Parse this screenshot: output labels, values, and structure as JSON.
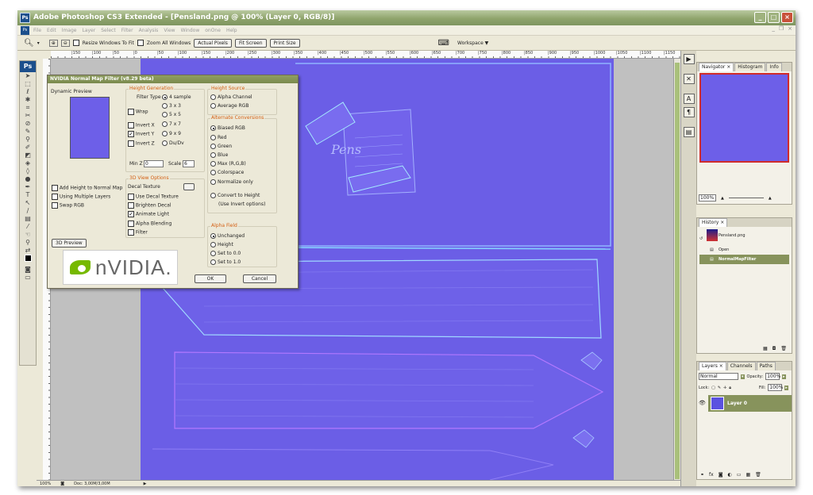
{
  "window": {
    "title": "Adobe Photoshop CS3 Extended - [Pensland.png @ 100% (Layer 0, RGB/8)]",
    "ps_badge": "Ps"
  },
  "menu": [
    "File",
    "Edit",
    "Image",
    "Layer",
    "Select",
    "Filter",
    "Analysis",
    "View",
    "Window",
    "onOne",
    "Help"
  ],
  "options": {
    "resize_windows": "Resize Windows To Fit",
    "zoom_all": "Zoom All Windows",
    "actual_pixels": "Actual Pixels",
    "fit_screen": "Fit Screen",
    "print_size": "Print Size",
    "workspace": "Workspace ▼"
  },
  "ruler_ticks": [
    "|150",
    "|100",
    "|50",
    "|0",
    "|50",
    "|100",
    "|150",
    "|200",
    "|250",
    "|300",
    "|350",
    "|400",
    "|450",
    "|500",
    "|550",
    "|600",
    "|650",
    "|700",
    "|750",
    "|800",
    "|850",
    "|900",
    "|950",
    "|1000",
    "|1050",
    "|1100",
    "|1150"
  ],
  "status": {
    "zoom": "100%",
    "doc": "Doc: 3,00M/3,00M"
  },
  "dialog": {
    "title": "NVIDIA Normal Map Filter (v8.29 beta)",
    "dynamic_preview": "Dynamic Preview",
    "height_generation": "Height Generation",
    "filter_type": "Filter Type",
    "ft_4sample": "4 sample",
    "ft_3x3": "3 x 3",
    "ft_5x5": "5 x 5",
    "ft_7x7": "7 x 7",
    "ft_9x9": "9 x 9",
    "ft_dudv": "Du/Dv",
    "wrap": "Wrap",
    "invert_x": "Invert X",
    "invert_y": "Invert Y",
    "invert_z": "Invert Z",
    "min_z": "Min Z",
    "min_z_value": "0",
    "scale": "Scale",
    "scale_value": "6",
    "height_source": "Height Source",
    "alpha_channel": "Alpha Channel",
    "average_rgb": "Average RGB",
    "alt_conversions": "Alternate Conversions",
    "biased_rgb": "Biased RGB",
    "red": "Red",
    "green": "Green",
    "blue": "Blue",
    "max_rgb": "Max (R,G,B)",
    "colorspace": "Colorspace",
    "normalize_only": "Normalize only",
    "convert_to_height": "Convert to Height",
    "use_invert": "(Use Invert options)",
    "view_options": "3D View Options",
    "decal_texture": "Decal Texture",
    "use_decal": "Use Decal Texture",
    "brighten_decal": "Brighten Decal",
    "animate_light": "Animate Light",
    "alpha_blending": "Alpha Blending",
    "filter": "Filter",
    "add_height": "Add Height to Normal Map",
    "multiple_layers": "Using Multiple Layers",
    "swap_rgb": "Swap RGB",
    "preview_3d": "3D Preview",
    "alpha_field": "Alpha Field",
    "unchanged": "Unchanged",
    "height": "Height",
    "set_0": "Set to 0.0",
    "set_1": "Set to 1.0",
    "ok": "OK",
    "cancel": "Cancel",
    "logo_text": "nVIDIA."
  },
  "navigator": {
    "tabs": [
      "Navigator ×",
      "Histogram",
      "Info"
    ],
    "zoom": "100%"
  },
  "history": {
    "tab": "History ×",
    "snapshot": "Pensland.png",
    "items": [
      "Open",
      "NormalMapFilter"
    ]
  },
  "layers": {
    "tabs": [
      "Layers ×",
      "Channels",
      "Paths"
    ],
    "blend_mode": "Normal",
    "opacity_label": "Opacity:",
    "opacity": "100%",
    "lock_label": "Lock:",
    "fill_label": "Fill:",
    "fill": "100%",
    "layer_name": "Layer 0"
  },
  "colors": {
    "canvas": "#6d5fe8",
    "accent": "#87935c",
    "title": "#8fa46c"
  }
}
